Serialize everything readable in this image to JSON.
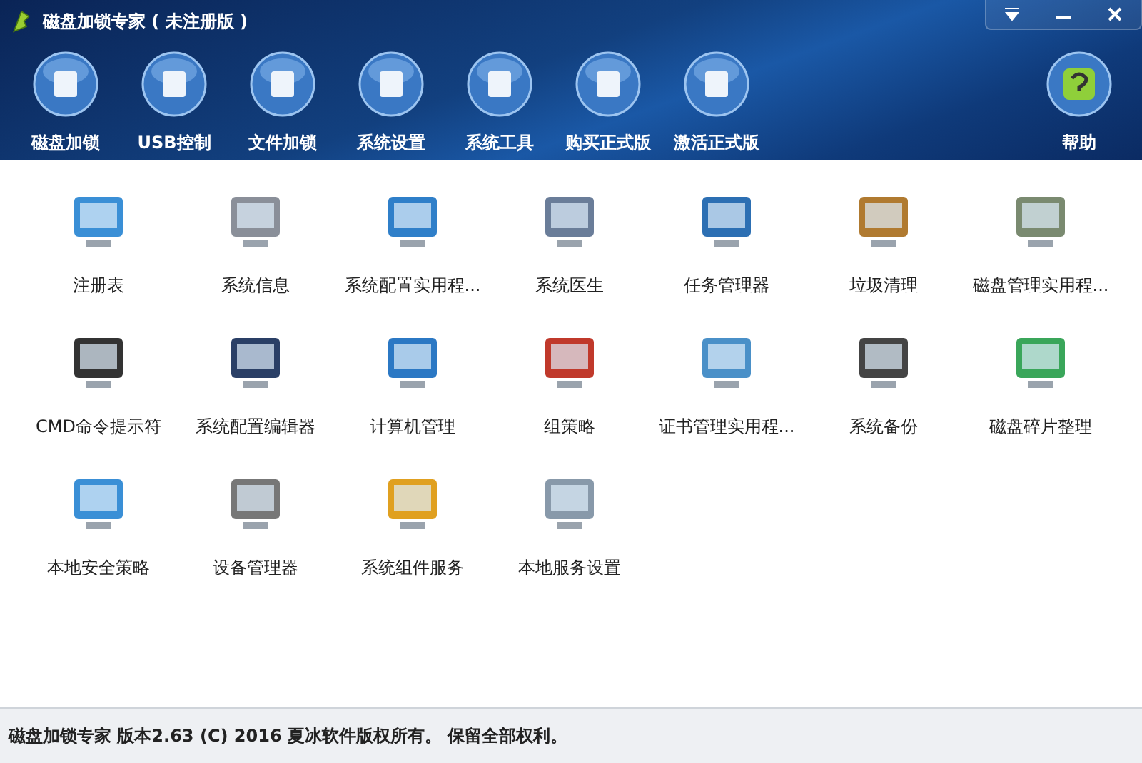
{
  "window": {
    "title": "磁盘加锁专家 ( 未注册版 )"
  },
  "toolbar": [
    {
      "label": "磁盘加锁"
    },
    {
      "label": "USB控制"
    },
    {
      "label": "文件加锁"
    },
    {
      "label": "系统设置"
    },
    {
      "label": "系统工具"
    },
    {
      "label": "购买正式版"
    },
    {
      "label": "激活正式版"
    }
  ],
  "help": {
    "label": "帮助"
  },
  "tools": [
    {
      "label": "注册表"
    },
    {
      "label": "系统信息"
    },
    {
      "label": "系统配置实用程..."
    },
    {
      "label": "系统医生"
    },
    {
      "label": "任务管理器"
    },
    {
      "label": "垃圾清理"
    },
    {
      "label": "磁盘管理实用程..."
    },
    {
      "label": "CMD命令提示符"
    },
    {
      "label": "系统配置编辑器"
    },
    {
      "label": "计算机管理"
    },
    {
      "label": "组策略"
    },
    {
      "label": "证书管理实用程..."
    },
    {
      "label": "系统备份"
    },
    {
      "label": "磁盘碎片整理"
    },
    {
      "label": "本地安全策略"
    },
    {
      "label": "设备管理器"
    },
    {
      "label": "系统组件服务"
    },
    {
      "label": "本地服务设置"
    }
  ],
  "status_bar": "磁盘加锁专家 版本2.63 (C) 2016 夏冰软件版权所有。 保留全部权利。"
}
